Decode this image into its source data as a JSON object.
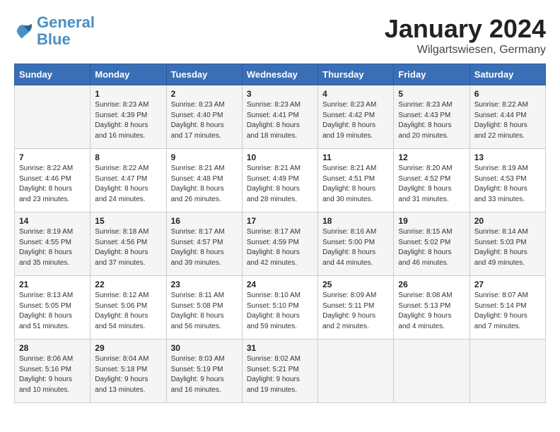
{
  "logo": {
    "line1": "General",
    "line2": "Blue"
  },
  "title": "January 2024",
  "location": "Wilgartswiesen, Germany",
  "days_of_week": [
    "Sunday",
    "Monday",
    "Tuesday",
    "Wednesday",
    "Thursday",
    "Friday",
    "Saturday"
  ],
  "weeks": [
    [
      {
        "day": "",
        "info": ""
      },
      {
        "day": "1",
        "info": "Sunrise: 8:23 AM\nSunset: 4:39 PM\nDaylight: 8 hours\nand 16 minutes."
      },
      {
        "day": "2",
        "info": "Sunrise: 8:23 AM\nSunset: 4:40 PM\nDaylight: 8 hours\nand 17 minutes."
      },
      {
        "day": "3",
        "info": "Sunrise: 8:23 AM\nSunset: 4:41 PM\nDaylight: 8 hours\nand 18 minutes."
      },
      {
        "day": "4",
        "info": "Sunrise: 8:23 AM\nSunset: 4:42 PM\nDaylight: 8 hours\nand 19 minutes."
      },
      {
        "day": "5",
        "info": "Sunrise: 8:23 AM\nSunset: 4:43 PM\nDaylight: 8 hours\nand 20 minutes."
      },
      {
        "day": "6",
        "info": "Sunrise: 8:22 AM\nSunset: 4:44 PM\nDaylight: 8 hours\nand 22 minutes."
      }
    ],
    [
      {
        "day": "7",
        "info": "Sunrise: 8:22 AM\nSunset: 4:46 PM\nDaylight: 8 hours\nand 23 minutes."
      },
      {
        "day": "8",
        "info": "Sunrise: 8:22 AM\nSunset: 4:47 PM\nDaylight: 8 hours\nand 24 minutes."
      },
      {
        "day": "9",
        "info": "Sunrise: 8:21 AM\nSunset: 4:48 PM\nDaylight: 8 hours\nand 26 minutes."
      },
      {
        "day": "10",
        "info": "Sunrise: 8:21 AM\nSunset: 4:49 PM\nDaylight: 8 hours\nand 28 minutes."
      },
      {
        "day": "11",
        "info": "Sunrise: 8:21 AM\nSunset: 4:51 PM\nDaylight: 8 hours\nand 30 minutes."
      },
      {
        "day": "12",
        "info": "Sunrise: 8:20 AM\nSunset: 4:52 PM\nDaylight: 8 hours\nand 31 minutes."
      },
      {
        "day": "13",
        "info": "Sunrise: 8:19 AM\nSunset: 4:53 PM\nDaylight: 8 hours\nand 33 minutes."
      }
    ],
    [
      {
        "day": "14",
        "info": "Sunrise: 8:19 AM\nSunset: 4:55 PM\nDaylight: 8 hours\nand 35 minutes."
      },
      {
        "day": "15",
        "info": "Sunrise: 8:18 AM\nSunset: 4:56 PM\nDaylight: 8 hours\nand 37 minutes."
      },
      {
        "day": "16",
        "info": "Sunrise: 8:17 AM\nSunset: 4:57 PM\nDaylight: 8 hours\nand 39 minutes."
      },
      {
        "day": "17",
        "info": "Sunrise: 8:17 AM\nSunset: 4:59 PM\nDaylight: 8 hours\nand 42 minutes."
      },
      {
        "day": "18",
        "info": "Sunrise: 8:16 AM\nSunset: 5:00 PM\nDaylight: 8 hours\nand 44 minutes."
      },
      {
        "day": "19",
        "info": "Sunrise: 8:15 AM\nSunset: 5:02 PM\nDaylight: 8 hours\nand 46 minutes."
      },
      {
        "day": "20",
        "info": "Sunrise: 8:14 AM\nSunset: 5:03 PM\nDaylight: 8 hours\nand 49 minutes."
      }
    ],
    [
      {
        "day": "21",
        "info": "Sunrise: 8:13 AM\nSunset: 5:05 PM\nDaylight: 8 hours\nand 51 minutes."
      },
      {
        "day": "22",
        "info": "Sunrise: 8:12 AM\nSunset: 5:06 PM\nDaylight: 8 hours\nand 54 minutes."
      },
      {
        "day": "23",
        "info": "Sunrise: 8:11 AM\nSunset: 5:08 PM\nDaylight: 8 hours\nand 56 minutes."
      },
      {
        "day": "24",
        "info": "Sunrise: 8:10 AM\nSunset: 5:10 PM\nDaylight: 8 hours\nand 59 minutes."
      },
      {
        "day": "25",
        "info": "Sunrise: 8:09 AM\nSunset: 5:11 PM\nDaylight: 9 hours\nand 2 minutes."
      },
      {
        "day": "26",
        "info": "Sunrise: 8:08 AM\nSunset: 5:13 PM\nDaylight: 9 hours\nand 4 minutes."
      },
      {
        "day": "27",
        "info": "Sunrise: 8:07 AM\nSunset: 5:14 PM\nDaylight: 9 hours\nand 7 minutes."
      }
    ],
    [
      {
        "day": "28",
        "info": "Sunrise: 8:06 AM\nSunset: 5:16 PM\nDaylight: 9 hours\nand 10 minutes."
      },
      {
        "day": "29",
        "info": "Sunrise: 8:04 AM\nSunset: 5:18 PM\nDaylight: 9 hours\nand 13 minutes."
      },
      {
        "day": "30",
        "info": "Sunrise: 8:03 AM\nSunset: 5:19 PM\nDaylight: 9 hours\nand 16 minutes."
      },
      {
        "day": "31",
        "info": "Sunrise: 8:02 AM\nSunset: 5:21 PM\nDaylight: 9 hours\nand 19 minutes."
      },
      {
        "day": "",
        "info": ""
      },
      {
        "day": "",
        "info": ""
      },
      {
        "day": "",
        "info": ""
      }
    ]
  ]
}
